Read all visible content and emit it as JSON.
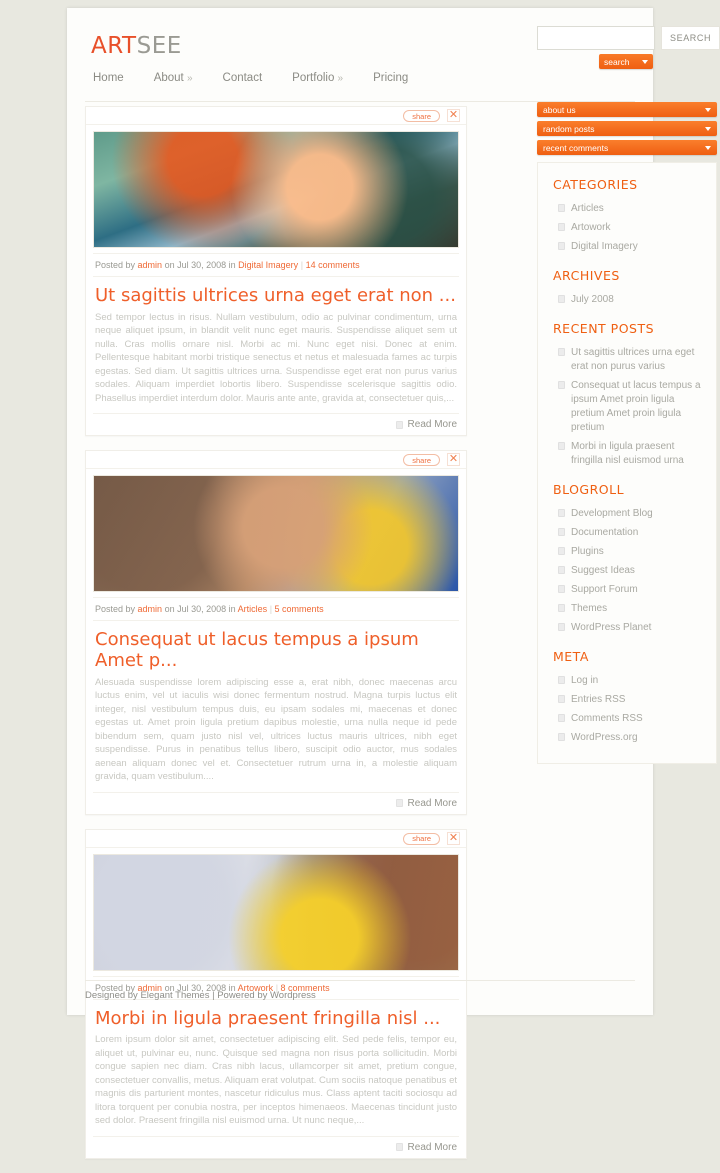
{
  "site": {
    "logo_primary": "ART",
    "logo_secondary": "SEE"
  },
  "nav": {
    "items": [
      {
        "label": "Home",
        "caret": ""
      },
      {
        "label": "About",
        "caret": "»"
      },
      {
        "label": "Contact",
        "caret": ""
      },
      {
        "label": "Portfolio",
        "caret": "»"
      },
      {
        "label": "Pricing",
        "caret": ""
      }
    ]
  },
  "search": {
    "value": "",
    "placeholder": "",
    "button_label": "SEARCH",
    "pill_label": "search"
  },
  "sidebar": {
    "bars": [
      {
        "label": "about us"
      },
      {
        "label": "random posts"
      },
      {
        "label": "recent comments"
      }
    ],
    "sections": [
      {
        "heading": "CATEGORIES",
        "items": [
          {
            "label": "Articles"
          },
          {
            "label": "Artowork"
          },
          {
            "label": "Digital Imagery"
          }
        ]
      },
      {
        "heading": "ARCHIVES",
        "items": [
          {
            "label": "July 2008"
          }
        ]
      },
      {
        "heading": "RECENT POSTS",
        "items": [
          {
            "label": "Ut sagittis ultrices urna eget erat non purus varius"
          },
          {
            "label": "Consequat ut lacus tempus a ipsum Amet proin ligula pretium Amet proin ligula pretium"
          },
          {
            "label": "Morbi in ligula praesent fringilla nisl euismod urna"
          }
        ]
      },
      {
        "heading": "BLOGROLL",
        "items": [
          {
            "label": "Development Blog"
          },
          {
            "label": "Documentation"
          },
          {
            "label": "Plugins"
          },
          {
            "label": "Suggest Ideas"
          },
          {
            "label": "Support Forum"
          },
          {
            "label": "Themes"
          },
          {
            "label": "WordPress Planet"
          }
        ]
      },
      {
        "heading": "META",
        "items": [
          {
            "label": "Log in"
          },
          {
            "label": "Entries RSS"
          },
          {
            "label": "Comments RSS"
          },
          {
            "label": "WordPress.org"
          }
        ]
      }
    ]
  },
  "posts": [
    {
      "share_label": "share",
      "close_label": "✕",
      "thumb_class": "t1",
      "meta": {
        "prefix": "Posted by",
        "author": "admin",
        "middle": "on Jul 30, 2008 in",
        "category": "Digital Imagery",
        "separator": "|",
        "comments": "14 comments"
      },
      "title": "Ut sagittis ultrices urna eget erat non ...",
      "body": "Sed tempor lectus in risus. Nullam vestibulum, odio ac pulvinar condimentum, urna neque aliquet ipsum, in blandit velit nunc eget mauris. Suspendisse aliquet sem ut nulla. Cras mollis ornare nisl. Morbi ac mi. Nunc eget nisi. Donec at enim. Pellentesque habitant morbi tristique senectus et netus et malesuada fames ac turpis egestas. Sed diam. Ut sagittis ultrices urna. Suspendisse eget erat non purus varius sodales. Aliquam imperdiet lobortis libero. Suspendisse scelerisque sagittis odio. Phasellus imperdiet interdum dolor. Mauris ante ante, gravida at, consectetuer quis,...",
      "read_more": "Read More"
    },
    {
      "share_label": "share",
      "close_label": "✕",
      "thumb_class": "t2",
      "meta": {
        "prefix": "Posted by",
        "author": "admin",
        "middle": "on Jul 30, 2008 in",
        "category": "Articles",
        "separator": "|",
        "comments": "5 comments"
      },
      "title": "Consequat ut lacus tempus a ipsum Amet p...",
      "body": "Alesuada suspendisse lorem adipiscing esse a, erat nibh, donec maecenas arcu luctus enim, vel ut iaculis wisi donec fermentum nostrud. Magna turpis luctus elit integer, nisl vestibulum tempus duis, eu ipsam sodales mi, maecenas et donec egestas ut. Amet proin ligula pretium dapibus molestie, urna nulla neque id pede bibendum sem, quam justo nisl vel, ultrices luctus mauris ultrices, nibh eget suspendisse. Purus in penatibus tellus libero, suscipit odio auctor, mus sodales aenean aliquam donec vel et. Consectetuer rutrum urna in, a molestie aliquam gravida, quam vestibulum....",
      "read_more": "Read More"
    },
    {
      "share_label": "share",
      "close_label": "✕",
      "thumb_class": "t3",
      "meta": {
        "prefix": "Posted by",
        "author": "admin",
        "middle": "on Jul 30, 2008 in",
        "category": "Artowork",
        "separator": "|",
        "comments": "8 comments"
      },
      "title": "Morbi in ligula praesent fringilla nisl ...",
      "body": "Lorem ipsum dolor sit amet, consectetuer adipiscing elit. Sed pede felis, tempor eu, aliquet ut, pulvinar eu, nunc. Quisque sed magna non risus porta sollicitudin. Morbi congue sapien nec diam. Cras nibh lacus, ullamcorper sit amet, pretium congue, consectetuer convallis, metus. Aliquam erat volutpat. Cum sociis natoque penatibus et magnis dis parturient montes, nascetur ridiculus mus. Class aptent taciti sociosqu ad litora torquent per conubia nostra, per inceptos himenaeos. Maecenas tincidunt justo sed dolor. Praesent fringilla nisl euismod urna. Ut nunc neque,...",
      "read_more": "Read More"
    }
  ],
  "footer": {
    "text": "Designed by Elegant Themes | Powered by Wordpress"
  },
  "colors": {
    "accent": "#ef5f12",
    "title": "#ef5f2a",
    "link": "#ef6a36",
    "body_text": "#c8c8c2",
    "page_bg": "#fdfdfb",
    "canvas_bg": "#e8e8e0"
  }
}
